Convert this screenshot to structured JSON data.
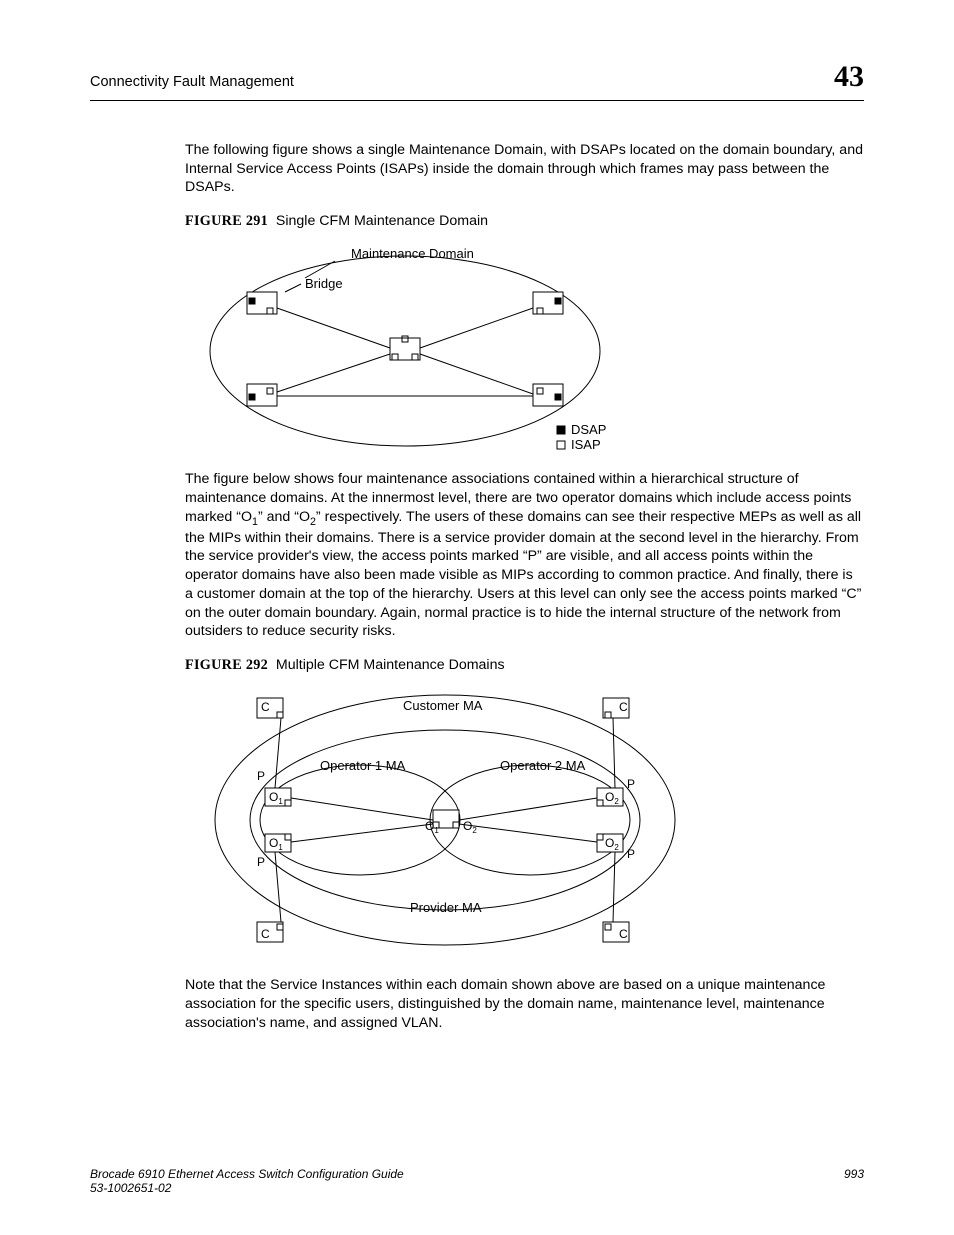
{
  "header": {
    "title": "Connectivity Fault Management",
    "chapter": "43"
  },
  "para1": "The following figure shows a single Maintenance Domain, with DSAPs located on the domain boundary, and Internal Service Access Points (ISAPs) inside the domain through which frames may pass between the DSAPs.",
  "fig291": {
    "label_prefix": "FIGURE 291",
    "caption": "Single CFM Maintenance Domain",
    "labels": {
      "bridge": "Bridge",
      "md": "Maintenance Domain",
      "dsap": "DSAP",
      "isap": "ISAP"
    }
  },
  "para2_a": "The figure below shows four maintenance associations contained within a hierarchical structure of maintenance domains. At the innermost level, there are two operator domains which include access points marked “O",
  "para2_sub1": "1",
  "para2_b": "” and “O",
  "para2_sub2": "2",
  "para2_c": "” respectively. The users of these domains can see their respective MEPs as well as all the MIPs within their domains. There is a service provider domain at the second level in the hierarchy. From the service provider's view, the access points marked “P” are visible, and all access points within the operator domains have also been made visible as MIPs according to common practice. And finally, there is a customer domain at the top of the hierarchy. Users at this level can only see the access points marked “C” on the outer domain boundary. Again, normal practice is to hide the internal structure of the network from outsiders to reduce security risks.",
  "fig292": {
    "label_prefix": "FIGURE 292",
    "caption": "Multiple CFM Maintenance Domains",
    "labels": {
      "c": "C",
      "customer_ma": "Customer MA",
      "p": "P",
      "operator1": "Operator 1 MA",
      "operator2": "Operator 2 MA",
      "o1": "O",
      "o2": "O",
      "provider": "Provider MA"
    }
  },
  "para3": "Note that the Service Instances within each domain shown above are based on a unique maintenance association for the specific users, distinguished by the domain name, maintenance level, maintenance association's name, and assigned VLAN.",
  "footer": {
    "line1": "Brocade 6910 Ethernet Access Switch Configuration Guide",
    "line2": "53-1002651-02",
    "page": "993"
  }
}
